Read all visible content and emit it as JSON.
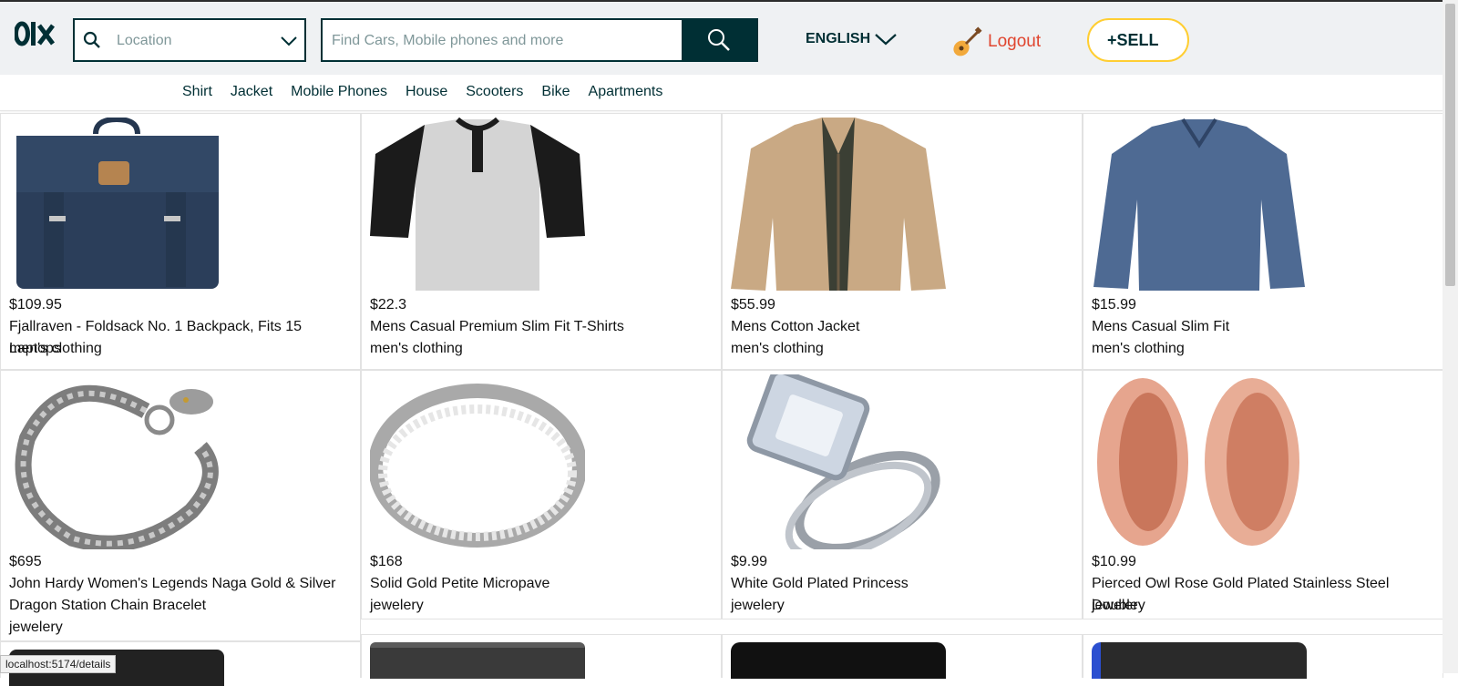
{
  "header": {
    "logo_text": "olx",
    "location_placeholder": "Location",
    "search_placeholder": "Find Cars, Mobile phones and more",
    "language": "ENGLISH",
    "logout": "Logout",
    "sell": "+SELL"
  },
  "categories": [
    "Shirt",
    "Jacket",
    "Mobile Phones",
    "House",
    "Scooters",
    "Bike",
    "Apartments"
  ],
  "products": [
    {
      "price": "$109.95",
      "title": "Fjallraven - Foldsack No. 1 Backpack, Fits 15 Laptops",
      "category": "men's clothing",
      "image": "backpack"
    },
    {
      "price": "$22.3",
      "title": "Mens Casual Premium Slim Fit T-Shirts",
      "category": "men's clothing",
      "image": "tshirt"
    },
    {
      "price": "$55.99",
      "title": "Mens Cotton Jacket",
      "category": "men's clothing",
      "image": "jacket"
    },
    {
      "price": "$15.99",
      "title": "Mens Casual Slim Fit",
      "category": "men's clothing",
      "image": "longsleeve"
    },
    {
      "price": "$695",
      "title": "John Hardy Women's Legends Naga Gold & Silver Dragon Station Chain Bracelet",
      "category": "jewelery",
      "image": "bracelet"
    },
    {
      "price": "$168",
      "title": "Solid Gold Petite Micropave",
      "category": "jewelery",
      "image": "ring"
    },
    {
      "price": "$9.99",
      "title": "White Gold Plated Princess",
      "category": "jewelery",
      "image": "diamond-ring"
    },
    {
      "price": "$10.99",
      "title": "Pierced Owl Rose Gold Plated Stainless Steel Double",
      "category": "jewelery",
      "image": "plugs"
    }
  ],
  "status_url": "localhost:5174/details",
  "colors": {
    "brand": "#002f34",
    "logout": "#e0452f",
    "sell_border": "#ffce32"
  }
}
